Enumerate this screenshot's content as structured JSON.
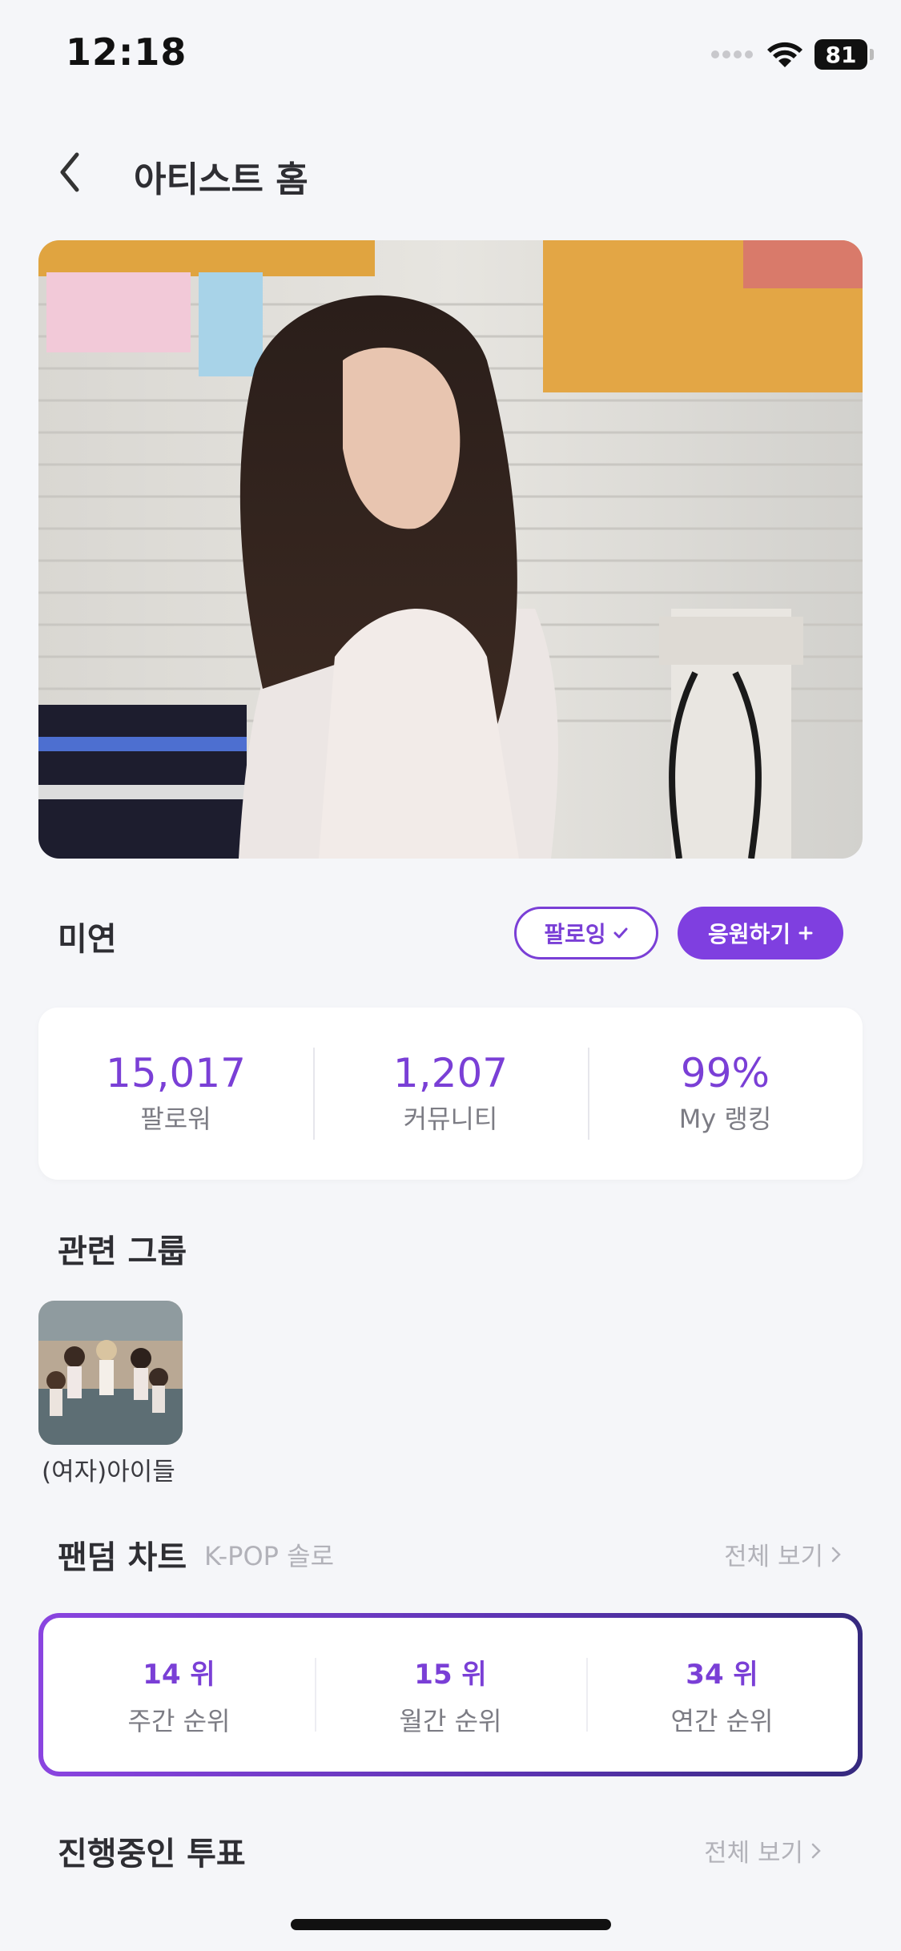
{
  "status_bar": {
    "time": "12:18",
    "battery": "81",
    "icons": [
      "signal-dots-icon",
      "wifi-icon",
      "battery-icon"
    ]
  },
  "header": {
    "back_icon": "chevron-left-icon",
    "title": "아티스트 홈"
  },
  "artist": {
    "name": "미연",
    "follow_label": "팔로잉",
    "follow_icon": "check-icon",
    "support_label": "응원하기",
    "support_icon": "plus-icon"
  },
  "stats": [
    {
      "value": "15,017",
      "label": "팔로워"
    },
    {
      "value": "1,207",
      "label": "커뮤니티"
    },
    {
      "value": "99%",
      "label": "My 랭킹"
    }
  ],
  "related_group": {
    "title": "관련 그룹",
    "groups": [
      {
        "name": "(여자)아이들"
      }
    ]
  },
  "fandom_chart": {
    "title": "팬덤 차트",
    "subtitle": "K-POP 솔로",
    "view_all": "전체 보기",
    "ranks": [
      {
        "value": "14 위",
        "label": "주간 순위"
      },
      {
        "value": "15 위",
        "label": "월간 순위"
      },
      {
        "value": "34 위",
        "label": "연간 순위"
      }
    ]
  },
  "votes": {
    "title": "진행중인 투표",
    "view_all": "전체 보기"
  },
  "colors": {
    "accent": "#7a3fd6",
    "background": "#f5f6f9"
  }
}
